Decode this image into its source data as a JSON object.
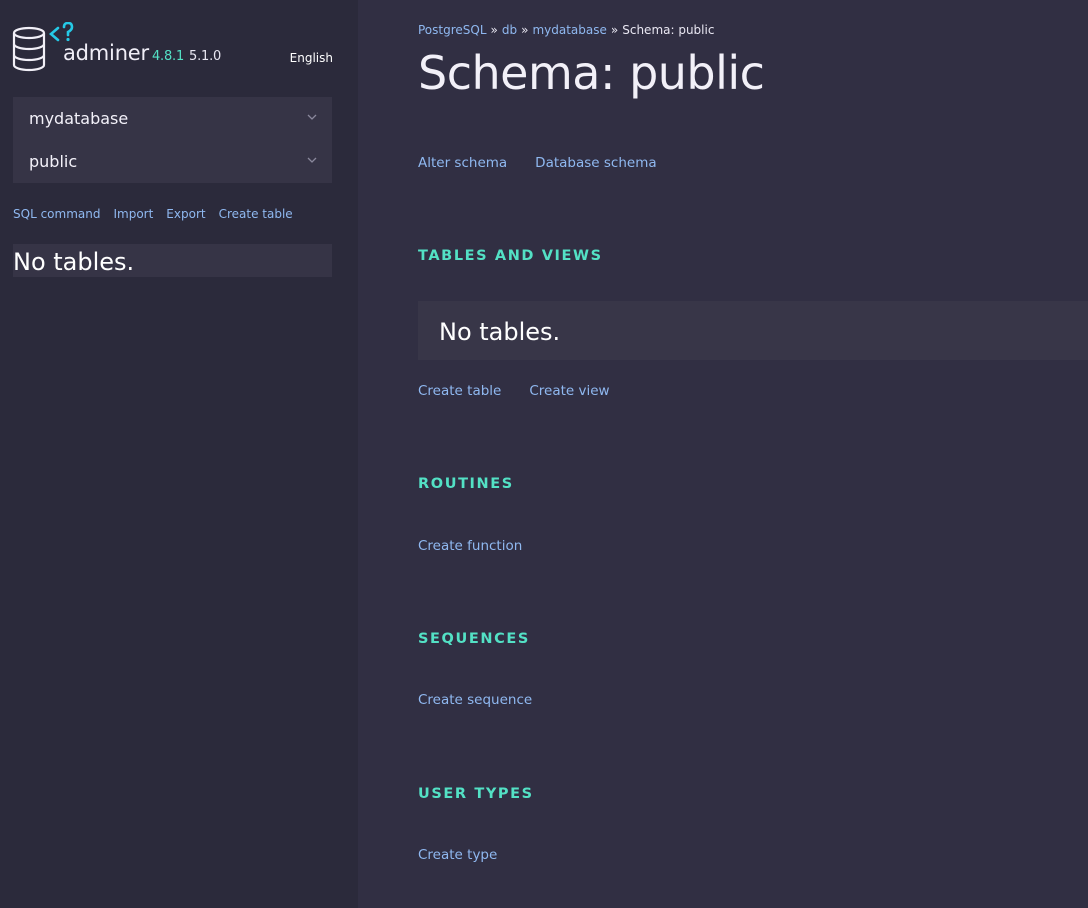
{
  "sidebar": {
    "app_name": "adminer",
    "app_version": "4.8.1",
    "app_version_alt": "5.1.0",
    "language": "English",
    "database_select": "mydatabase",
    "schema_select": "public",
    "links": [
      "SQL command",
      "Import",
      "Export",
      "Create table"
    ],
    "no_tables": "No tables."
  },
  "breadcrumb": {
    "items": [
      "PostgreSQL",
      "db",
      "mydatabase"
    ],
    "separator": "»",
    "current": "Schema: public"
  },
  "page": {
    "title": "Schema: public",
    "schema_links": [
      "Alter schema",
      "Database schema"
    ]
  },
  "sections": {
    "tables": {
      "heading": "Tables and views",
      "empty_text": "No tables.",
      "links": [
        "Create table",
        "Create view"
      ]
    },
    "routines": {
      "heading": "Routines",
      "links": [
        "Create function"
      ]
    },
    "sequences": {
      "heading": "Sequences",
      "links": [
        "Create sequence"
      ]
    },
    "user_types": {
      "heading": "User types",
      "links": [
        "Create type"
      ]
    }
  },
  "colors": {
    "background": "#312f43",
    "sidebar": "#2b2a3b",
    "accent": "#53e1c5",
    "link": "#8fb8f0"
  }
}
